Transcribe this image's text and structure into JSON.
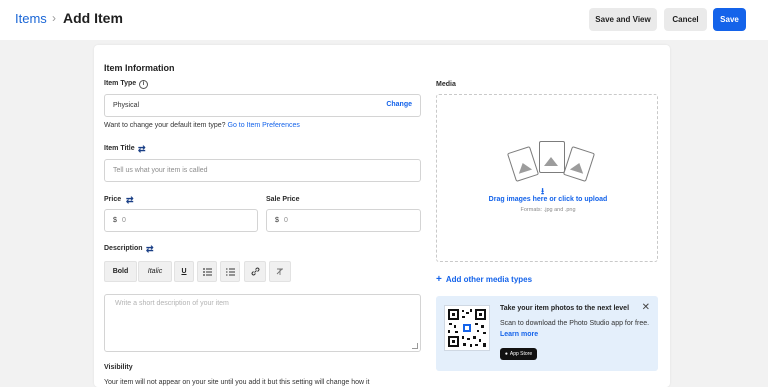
{
  "header": {
    "breadcrumb": "Items",
    "separator": "›",
    "title": "Add Item",
    "save_and_view": "Save and View",
    "cancel": "Cancel",
    "save": "Save"
  },
  "form": {
    "section_title": "Item Information",
    "item_type": {
      "label": "Item Type",
      "value": "Physical",
      "change": "Change"
    },
    "default_hint": "Want to change your default item type?",
    "default_hint_link": "Go to Item Preferences",
    "item_title": {
      "label": "Item Title",
      "placeholder": "Tell us what your item is called"
    },
    "price": {
      "label": "Price",
      "currency": "$",
      "placeholder": "0"
    },
    "sale_price": {
      "label": "Sale Price",
      "currency": "$",
      "placeholder": "0"
    },
    "description": {
      "label": "Description",
      "toolbar": {
        "bold": "Bold",
        "italic": "Italic",
        "underline": "U"
      },
      "placeholder": "Write a short description of your item"
    },
    "visibility": {
      "label": "Visibility",
      "text": "Your item will not appear on your site until you add it but this setting will change how it"
    }
  },
  "media": {
    "label": "Media",
    "drag_text": "Drag images here or click to upload",
    "formats": "Formats: .jpg and .png",
    "add_other": "Add other media types"
  },
  "promo": {
    "title": "Take your item photos to the next level",
    "text": "Scan to download the Photo Studio app for free.",
    "link": "Learn more",
    "badge": "App Store"
  },
  "colors": {
    "accent": "#1463ea",
    "link": "#1a66d6",
    "background": "#f2f2f2",
    "promo_bg": "#e4effb"
  }
}
